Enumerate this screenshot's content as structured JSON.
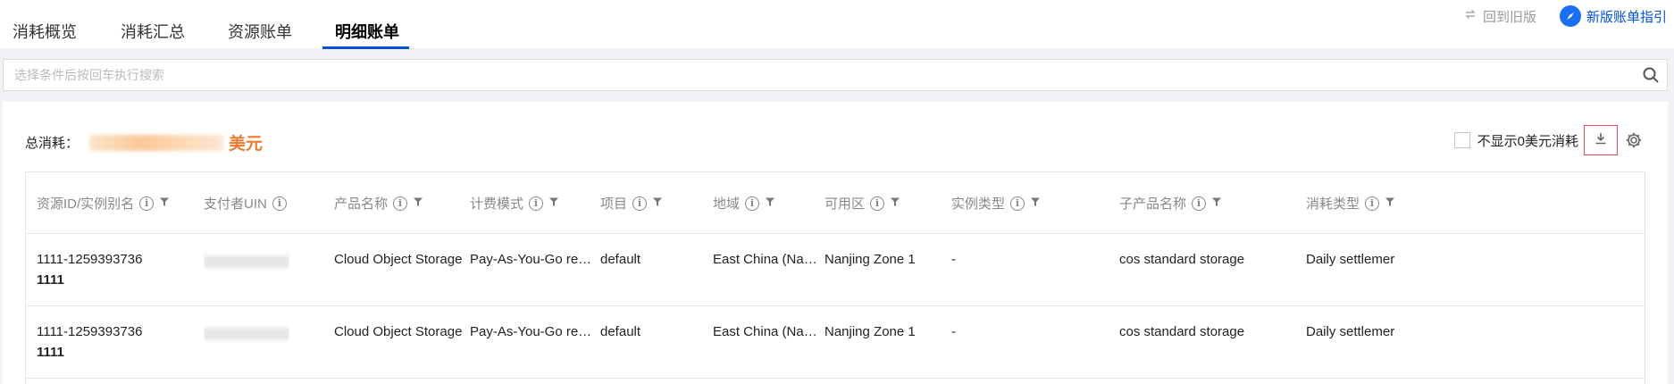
{
  "tabs": [
    {
      "label": "消耗概览"
    },
    {
      "label": "消耗汇总"
    },
    {
      "label": "资源账单"
    },
    {
      "label": "明细账单"
    }
  ],
  "active_tab": "明细账单",
  "header": {
    "old_version": "回到旧版",
    "guide": "新版账单指引"
  },
  "search": {
    "placeholder": "选择条件后按回车执行搜索"
  },
  "summary": {
    "label": "总消耗：",
    "unit": "美元"
  },
  "toolbar": {
    "hide_zero_label": "不显示0美元消耗"
  },
  "table": {
    "columns": [
      {
        "label": "资源ID/实例别名",
        "info": true,
        "filter": true
      },
      {
        "label": "支付者UIN",
        "info": true,
        "filter": false
      },
      {
        "label": "产品名称",
        "info": true,
        "filter": true
      },
      {
        "label": "计费模式",
        "info": true,
        "filter": true
      },
      {
        "label": "项目",
        "info": true,
        "filter": true
      },
      {
        "label": "地域",
        "info": true,
        "filter": true
      },
      {
        "label": "可用区",
        "info": true,
        "filter": true
      },
      {
        "label": "实例类型",
        "info": true,
        "filter": true
      },
      {
        "label": "子产品名称",
        "info": true,
        "filter": true
      },
      {
        "label": "消耗类型",
        "info": true,
        "filter": true
      }
    ],
    "rows": [
      {
        "resource_id": "1111-1259393736",
        "alias": "1111",
        "product": "Cloud Object Storage",
        "billing_mode": "Pay-As-You-Go res…",
        "project": "default",
        "region": "East China (Na…",
        "zone": "Nanjing Zone 1",
        "instance_type": "-",
        "sub_product": "cos standard storage",
        "consumption_type": "Daily settlemer"
      },
      {
        "resource_id": "1111-1259393736",
        "alias": "1111",
        "product": "Cloud Object Storage",
        "billing_mode": "Pay-As-You-Go res…",
        "project": "default",
        "region": "East China (Na…",
        "zone": "Nanjing Zone 1",
        "instance_type": "-",
        "sub_product": "cos standard storage",
        "consumption_type": "Daily settlemer"
      }
    ]
  },
  "colors": {
    "accent": "#0052d9",
    "orange": "#ed7b2f",
    "highlight_border": "#e34d59"
  }
}
